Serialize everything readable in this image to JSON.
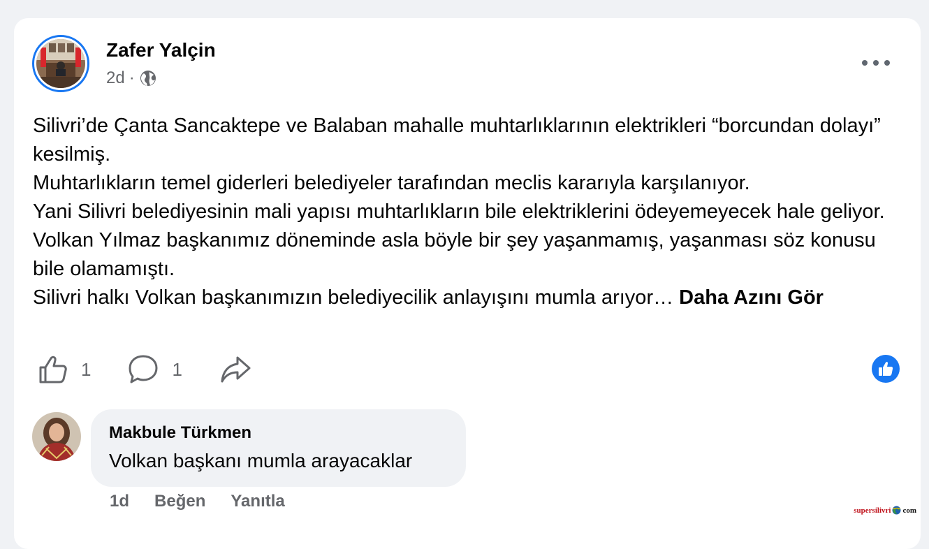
{
  "post": {
    "author": "Zafer Yalçin",
    "time": "2d",
    "separator": "·",
    "privacy_icon": "globe-icon",
    "lines": [
      "Silivri’de Çanta Sancaktepe ve Balaban mahalle muhtarlıklarının elektrikleri “borcundan dolayı” kesilmiş.",
      "Muhtarlıkların temel giderleri belediyeler tarafından meclis kararıyla karşılanıyor.",
      "Yani Silivri belediyesinin mali yapısı muhtarlıkların bile elektriklerini ödeyemeyecek hale geliyor.",
      "Volkan Yılmaz başkanımız döneminde asla böyle bir şey yaşanmamış, yaşanması söz konusu bile olamamıştı."
    ],
    "last_line": "Silivri halkı Volkan başkanımızın belediyecilik anlayışını mumla arıyor…",
    "see_more": "Daha Azını Gör"
  },
  "actions": {
    "like_count": "1",
    "comment_count": "1"
  },
  "comment": {
    "author": "Makbule Türkmen",
    "text": "Volkan başkanı mumla arayacaklar",
    "time": "1d",
    "like_label": "Beğen",
    "reply_label": "Yanıtla"
  },
  "watermark": {
    "brand": "supersilivri",
    "tld": "com"
  },
  "colors": {
    "accent": "#1877f2",
    "secondary_text": "#65676b",
    "bubble": "#f0f2f5",
    "watermark_red": "#c0121b"
  }
}
